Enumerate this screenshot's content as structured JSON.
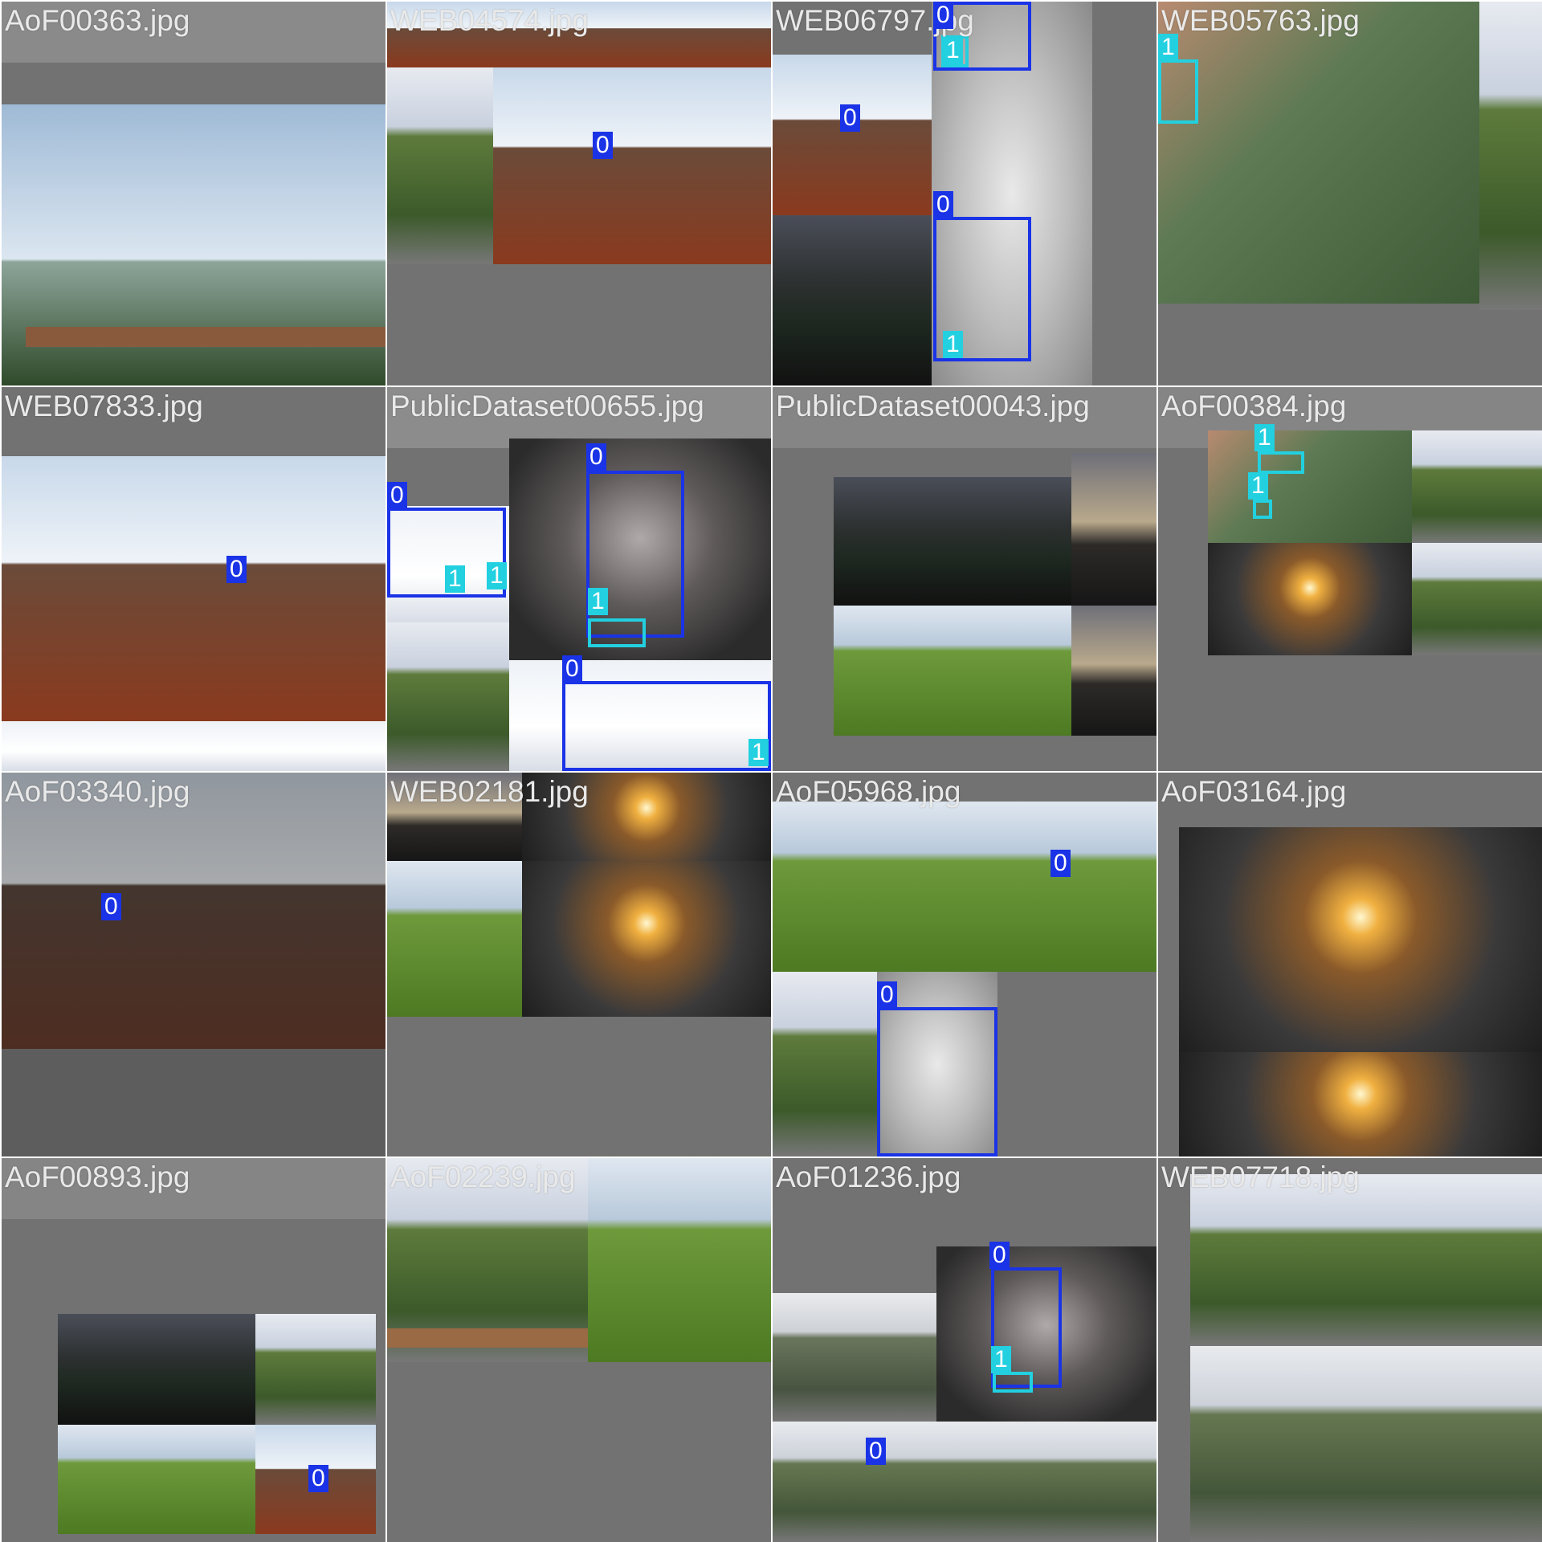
{
  "tiles": [
    {
      "name": "AoF00363.jpg"
    },
    {
      "name": "WEB04574.jpg"
    },
    {
      "name": "WEB06797.jpg"
    },
    {
      "name": "WEB05763.jpg"
    },
    {
      "name": "WEB07833.jpg"
    },
    {
      "name": "PublicDataset00655.jpg"
    },
    {
      "name": "PublicDataset00043.jpg"
    },
    {
      "name": "AoF00384.jpg"
    },
    {
      "name": "AoF03340.jpg"
    },
    {
      "name": "WEB02181.jpg"
    },
    {
      "name": "AoF05968.jpg"
    },
    {
      "name": "AoF03164.jpg"
    },
    {
      "name": "AoF00893.jpg"
    },
    {
      "name": "AoF02239.jpg"
    },
    {
      "name": "AoF01236.jpg"
    },
    {
      "name": "WEB07718.jpg"
    }
  ],
  "class_labels": {
    "smoke": "0",
    "fire": "1"
  },
  "colors": {
    "class0": "#1a33e6",
    "class1": "#22d0e0",
    "tile_bg": "#727272"
  }
}
